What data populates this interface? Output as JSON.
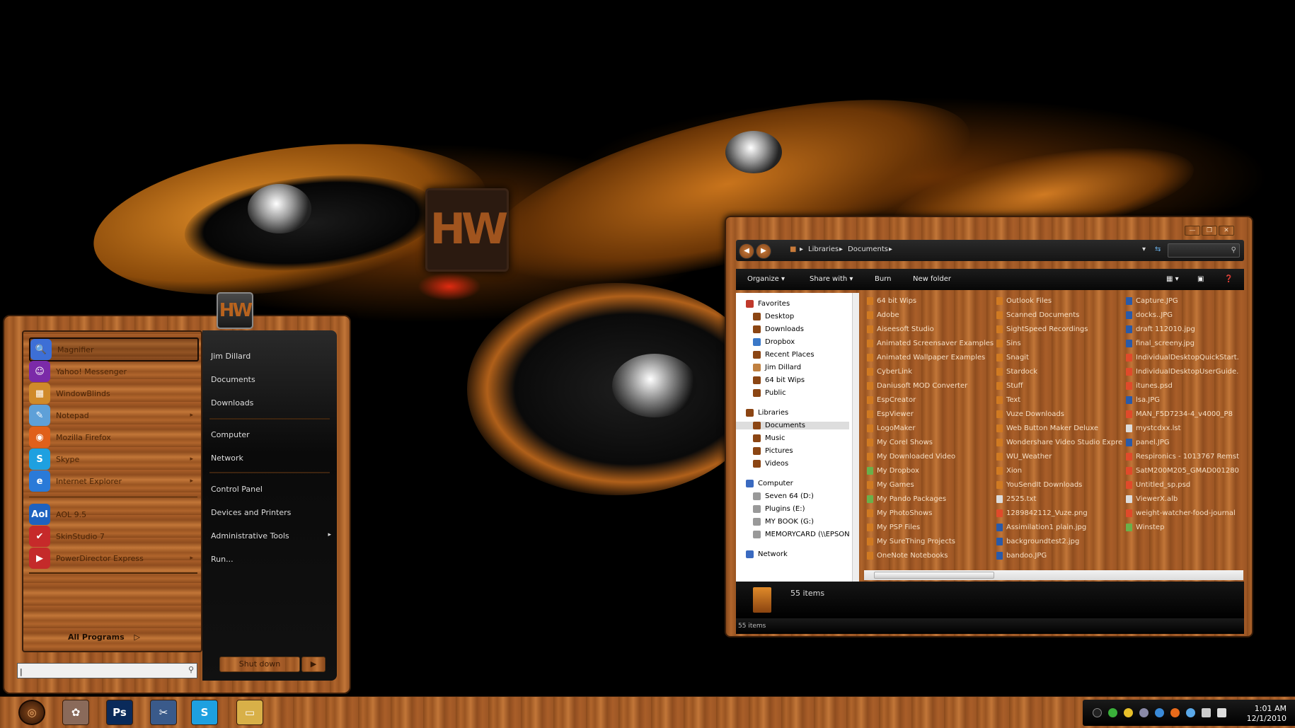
{
  "desktop": {
    "logo": "HW"
  },
  "start_menu": {
    "user_picture_text": "HW",
    "programs": [
      {
        "label": "Magnifier",
        "icon": "magnifier-icon",
        "color": "#3d6fd6",
        "glyph": "🔍",
        "submenu": false,
        "selected": true
      },
      {
        "label": "Yahoo! Messenger",
        "icon": "yahoo-messenger-icon",
        "color": "#7b2aa8",
        "glyph": "☺",
        "submenu": false
      },
      {
        "label": "WindowBlinds",
        "icon": "windowblinds-icon",
        "color": "#d08a2a",
        "glyph": "▦",
        "submenu": false
      },
      {
        "label": "Notepad",
        "icon": "notepad-icon",
        "color": "#5ea0d8",
        "glyph": "✎",
        "submenu": true
      },
      {
        "label": "Mozilla Firefox",
        "icon": "firefox-icon",
        "color": "#e0601a",
        "glyph": "◉",
        "submenu": false
      },
      {
        "label": "Skype",
        "icon": "skype-icon",
        "color": "#1ea0e0",
        "glyph": "S",
        "submenu": true
      },
      {
        "label": "Internet Explorer",
        "icon": "internet-explorer-icon",
        "color": "#2a7ad8",
        "glyph": "e",
        "submenu": true
      },
      {
        "label": "AOL 9.5",
        "icon": "aol-icon",
        "color": "#1e62c0",
        "glyph": "Aol",
        "submenu": false
      },
      {
        "label": "SkinStudio 7",
        "icon": "skinstudio-icon",
        "color": "#c62a2a",
        "glyph": "✔",
        "submenu": false
      },
      {
        "label": "PowerDirector Express",
        "icon": "powerdirector-icon",
        "color": "#c42a2a",
        "glyph": "▶",
        "submenu": true
      }
    ],
    "all_programs": "All Programs",
    "right_links": [
      {
        "label": "Jim Dillard",
        "submenu": false
      },
      {
        "label": "Documents",
        "submenu": false
      },
      {
        "label": "Downloads",
        "submenu": false
      },
      {
        "label": "Computer",
        "submenu": false
      },
      {
        "label": "Network",
        "submenu": false
      },
      {
        "label": "Control Panel",
        "submenu": false
      },
      {
        "label": "Devices and Printers",
        "submenu": false
      },
      {
        "label": "Administrative Tools",
        "submenu": true
      },
      {
        "label": "Run...",
        "submenu": false
      }
    ],
    "search_value": "|",
    "shutdown": "Shut down"
  },
  "explorer": {
    "window_buttons": [
      "—",
      "❐",
      "✕"
    ],
    "breadcrumb": [
      "Libraries",
      "Documents"
    ],
    "toolbar": [
      "Organize ▾",
      "Share with ▾",
      "Burn",
      "New folder"
    ],
    "nav": [
      {
        "label": "Favorites",
        "indent": 0,
        "color": "#c0392b",
        "group": true
      },
      {
        "label": "Desktop",
        "indent": 1,
        "color": "#8b4513"
      },
      {
        "label": "Downloads",
        "indent": 1,
        "color": "#8b4513"
      },
      {
        "label": "Dropbox",
        "indent": 1,
        "color": "#3a78c8"
      },
      {
        "label": "Recent Places",
        "indent": 1,
        "color": "#8b4513"
      },
      {
        "label": "Jim Dillard",
        "indent": 1,
        "color": "#c08040"
      },
      {
        "label": "64 bit Wips",
        "indent": 1,
        "color": "#8b4513"
      },
      {
        "label": "Public",
        "indent": 1,
        "color": "#8b4513"
      },
      {
        "label": "Libraries",
        "indent": 0,
        "color": "#8b4513",
        "group": true
      },
      {
        "label": "Documents",
        "indent": 1,
        "color": "#8b4513",
        "selected": true
      },
      {
        "label": "Music",
        "indent": 1,
        "color": "#8b4513"
      },
      {
        "label": "Pictures",
        "indent": 1,
        "color": "#8b4513"
      },
      {
        "label": "Videos",
        "indent": 1,
        "color": "#8b4513"
      },
      {
        "label": "Computer",
        "indent": 0,
        "color": "#3a6ac0",
        "group": true
      },
      {
        "label": "Seven 64 (D:)",
        "indent": 1,
        "color": "#999"
      },
      {
        "label": "Plugins (E:)",
        "indent": 1,
        "color": "#999"
      },
      {
        "label": "MY BOOK (G:)",
        "indent": 1,
        "color": "#999"
      },
      {
        "label": "MEMORYCARD (\\\\EPSON",
        "indent": 1,
        "color": "#999"
      },
      {
        "label": "Network",
        "indent": 0,
        "color": "#3a6ac0",
        "group": true
      }
    ],
    "files_col1": [
      "64 bit Wips",
      "Adobe",
      "Aiseesoft Studio",
      "Animated Screensaver Examples",
      "Animated Wallpaper Examples",
      "CyberLink",
      "Daniusoft MOD Converter",
      "EspCreator",
      "EspViewer",
      "LogoMaker",
      "My Corel Shows",
      "My Downloaded Video",
      "My Dropbox",
      "My Games",
      "My Pando Packages",
      "My PhotoShows",
      "My PSP Files",
      "My SureThing Projects",
      "OneNote Notebooks"
    ],
    "files_col2": [
      "Outlook Files",
      "Scanned Documents",
      "SightSpeed Recordings",
      "Sins",
      "Snagit",
      "Stardock",
      "Stuff",
      "Text",
      "Vuze Downloads",
      "Web Button Maker Deluxe",
      "Wondershare Video Studio Express",
      "WU_Weather",
      "Xion",
      "YouSendIt Downloads",
      "2525.txt",
      "1289842112_Vuze.png",
      "Assimilation1 plain.jpg",
      "backgroundtest2.jpg",
      "bandoo.JPG"
    ],
    "files_col3": [
      "Capture.JPG",
      "docks..JPG",
      "draft 112010.jpg",
      "final_screeny.jpg",
      "IndividualDesktopQuickStart.",
      "IndividualDesktopUserGuide.",
      "itunes.psd",
      "lsa.JPG",
      "MAN_F5D7234-4_v4000_P8",
      "mystcdxx.lst",
      "panel.JPG",
      "Respironics - 1013767 Remst",
      "SatM200M205_GMAD001280",
      "Untitled_sp.psd",
      "ViewerX.alb",
      "weight-watcher-food-journal",
      "Winstep"
    ],
    "details_count": "55 items",
    "status_count": "55 items"
  },
  "taskbar": {
    "apps": [
      {
        "name": "start-orb",
        "glyph": "◎",
        "color": "#5a3010"
      },
      {
        "name": "paint-icon",
        "glyph": "✿",
        "color": "#8a6a5a"
      },
      {
        "name": "photoshop-icon",
        "glyph": "Ps",
        "color": "#0a2a5a"
      },
      {
        "name": "tools-icon",
        "glyph": "✂",
        "color": "#3a5a8a"
      },
      {
        "name": "skype-icon",
        "glyph": "S",
        "color": "#1ea0e0"
      },
      {
        "name": "folder-icon",
        "glyph": "▭",
        "color": "#d8b048"
      }
    ],
    "time": "1:01 AM",
    "date": "12/1/2010"
  }
}
